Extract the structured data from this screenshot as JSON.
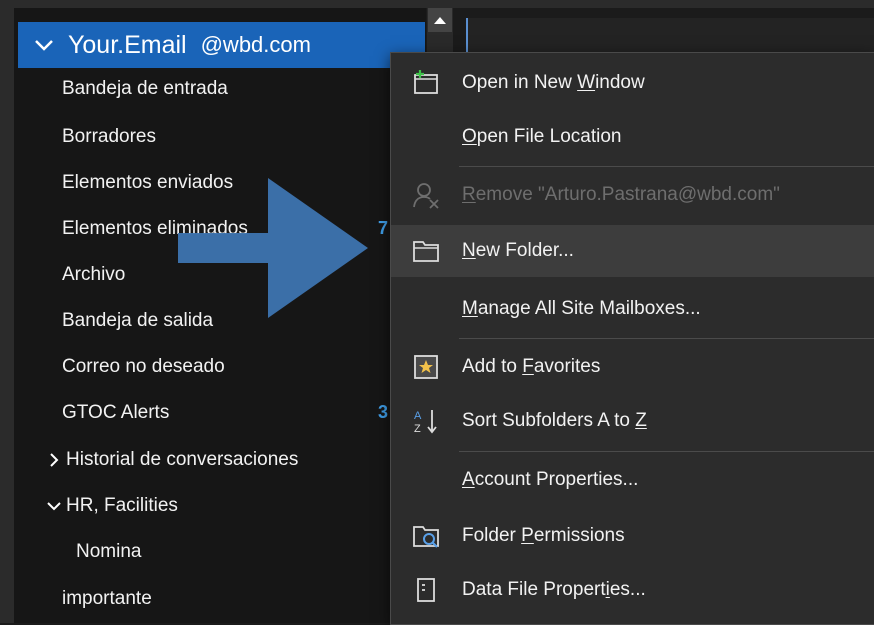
{
  "account": {
    "name": "Your.Email",
    "domain": "@wbd.com"
  },
  "folders": [
    {
      "label": "Bandeja de entrada"
    },
    {
      "label": "Borradores"
    },
    {
      "label": "Elementos enviados"
    },
    {
      "label": "Elementos eliminados",
      "count": "7"
    },
    {
      "label": "Archivo"
    },
    {
      "label": "Bandeja de salida"
    },
    {
      "label": "Correo no deseado"
    },
    {
      "label": "GTOC Alerts",
      "count": "3"
    },
    {
      "label": "Historial de conversaciones"
    },
    {
      "label": "HR, Facilities"
    },
    {
      "label": "Nomina"
    },
    {
      "label": "importante"
    }
  ],
  "context_menu": {
    "items": [
      {
        "pre": "Open in New ",
        "acc": "W",
        "post": "indow",
        "icon": "new-window-icon"
      },
      {
        "pre": "",
        "acc": "O",
        "post": "pen File Location",
        "icon": ""
      },
      {
        "pre": "",
        "acc": "R",
        "post": "emove \"Arturo.Pastrana@wbd.com\"",
        "icon": "remove-person-icon",
        "disabled": true
      },
      {
        "pre": "",
        "acc": "N",
        "post": "ew Folder...",
        "icon": "folder-icon",
        "highlighted": true
      },
      {
        "pre": "",
        "acc": "M",
        "post": "anage All Site Mailboxes...",
        "icon": ""
      },
      {
        "pre": "Add to ",
        "acc": "F",
        "post": "avorites",
        "icon": "star-favorites-icon"
      },
      {
        "pre": "Sort Subfolders A to ",
        "acc": "Z",
        "post": "",
        "icon": "sort-az-icon"
      },
      {
        "pre": "",
        "acc": "A",
        "post": "ccount Properties...",
        "icon": ""
      },
      {
        "pre": "Folder ",
        "acc": "P",
        "post": "ermissions",
        "icon": "folder-permissions-icon"
      },
      {
        "pre": "Data File Propert",
        "acc": "i",
        "post": "es...",
        "icon": "data-file-icon"
      }
    ]
  },
  "colors": {
    "accent": "#1a64b8",
    "count_blue": "#3f9ee8",
    "arrow_blue": "#3d74b0",
    "menu_bg": "#2c2c2c"
  }
}
